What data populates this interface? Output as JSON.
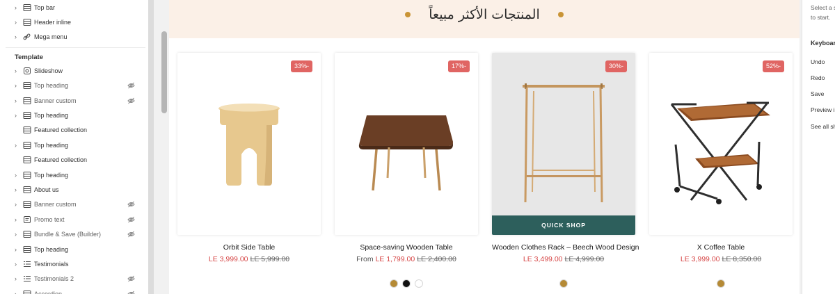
{
  "sidebar": {
    "header_items": [
      {
        "label": "Top bar",
        "icon": "layout-icon"
      },
      {
        "label": "Header inline",
        "icon": "layout-icon"
      },
      {
        "label": "Mega menu",
        "icon": "link-icon"
      }
    ],
    "template_title": "Template",
    "template_items": [
      {
        "label": "Slideshow",
        "icon": "slideshow-icon",
        "chevron": true,
        "hidden": false
      },
      {
        "label": "Top heading",
        "icon": "layout-icon",
        "chevron": true,
        "hidden": true
      },
      {
        "label": "Banner custom",
        "icon": "layout-icon",
        "chevron": true,
        "hidden": true
      },
      {
        "label": "Top heading",
        "icon": "layout-icon",
        "chevron": true,
        "hidden": false
      },
      {
        "label": "Featured collection",
        "icon": "layout-icon",
        "chevron": false,
        "hidden": false
      },
      {
        "label": "Top heading",
        "icon": "layout-icon",
        "chevron": true,
        "hidden": false
      },
      {
        "label": "Featured collection",
        "icon": "layout-icon",
        "chevron": false,
        "hidden": false
      },
      {
        "label": "Top heading",
        "icon": "layout-icon",
        "chevron": true,
        "hidden": false
      },
      {
        "label": "About us",
        "icon": "layout-icon",
        "chevron": true,
        "hidden": false
      },
      {
        "label": "Banner custom",
        "icon": "layout-icon",
        "chevron": true,
        "hidden": true
      },
      {
        "label": "Promo text",
        "icon": "text-icon",
        "chevron": true,
        "hidden": true
      },
      {
        "label": "Bundle & Save (Builder)",
        "icon": "layout-icon",
        "chevron": true,
        "hidden": true
      },
      {
        "label": "Top heading",
        "icon": "layout-icon",
        "chevron": true,
        "hidden": false
      },
      {
        "label": "Testimonials",
        "icon": "list-icon",
        "chevron": true,
        "hidden": false
      },
      {
        "label": "Testimonials 2",
        "icon": "list-icon",
        "chevron": true,
        "hidden": true
      },
      {
        "label": "Accordion",
        "icon": "layout-icon",
        "chevron": true,
        "hidden": true
      }
    ]
  },
  "preview": {
    "section_title": "المنتجات الأكثر مبيعاً",
    "accent_color": "#c99436",
    "quick_shop_label": "QUICK SHOP",
    "products": [
      {
        "name": "Orbit Side Table",
        "badge": "33%-",
        "from": "",
        "price": "LE 3,999.00",
        "old_price": "LE 5,999.00",
        "swatches": []
      },
      {
        "name": "Space-saving Wooden Table",
        "badge": "17%-",
        "from": "From",
        "price": "LE 1,799.00",
        "old_price": "LE 2,400.00",
        "swatches": [
          "#b58a35",
          "#111111",
          "#ffffff"
        ]
      },
      {
        "name": "Wooden Clothes Rack – Beech Wood Design",
        "badge": "30%-",
        "from": "",
        "price": "LE 3,499.00",
        "old_price": "LE 4,999.00",
        "swatches": [
          "#b58a35"
        ]
      },
      {
        "name": "X Coffee Table",
        "badge": "52%-",
        "from": "",
        "price": "LE 3,999.00",
        "old_price": "LE 8,350.00",
        "swatches": [
          "#b58a35"
        ]
      }
    ]
  },
  "right_panel": {
    "hint_line1": "Select a s",
    "hint_line2": "to start.",
    "keyboard_title": "Keyboar",
    "shortcuts": [
      "Undo",
      "Redo",
      "Save",
      "Preview i",
      "See all sh"
    ]
  }
}
